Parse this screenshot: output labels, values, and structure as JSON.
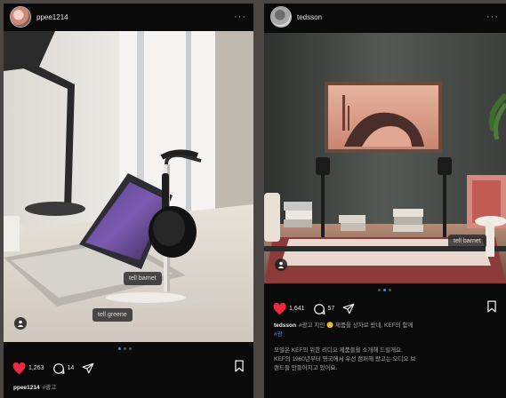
{
  "posts": [
    {
      "username": "ppee1214",
      "more": "···",
      "tags": [
        "tell barnet",
        "tell greene"
      ],
      "likes": "1,263",
      "comments": "14",
      "caption": {
        "user": "ppee1214",
        "text": "#광고"
      }
    },
    {
      "username": "tedsson",
      "more": "···",
      "tags": [
        "tell barnet"
      ],
      "likes": "1,641",
      "comments": "57",
      "caption": {
        "user": "tedsson",
        "text": "#광고 지인 🙂 제품을 상자로 왔네, KEF의 함께",
        "hashtag": "#광",
        "body1": "모델은 KEF의 위한 리디오 제품들을 소개해 드릴게요.",
        "body2": "KEF의 1960년부터 영국에서 우선 캠퍼해 왔고는 오디오 브",
        "body3": "랜드들 만들어지고 있어요."
      }
    }
  ],
  "colors": {
    "like": "#ee2a3e",
    "dot_active": "#3a8cf0",
    "hashtag": "#5a8ee6"
  }
}
